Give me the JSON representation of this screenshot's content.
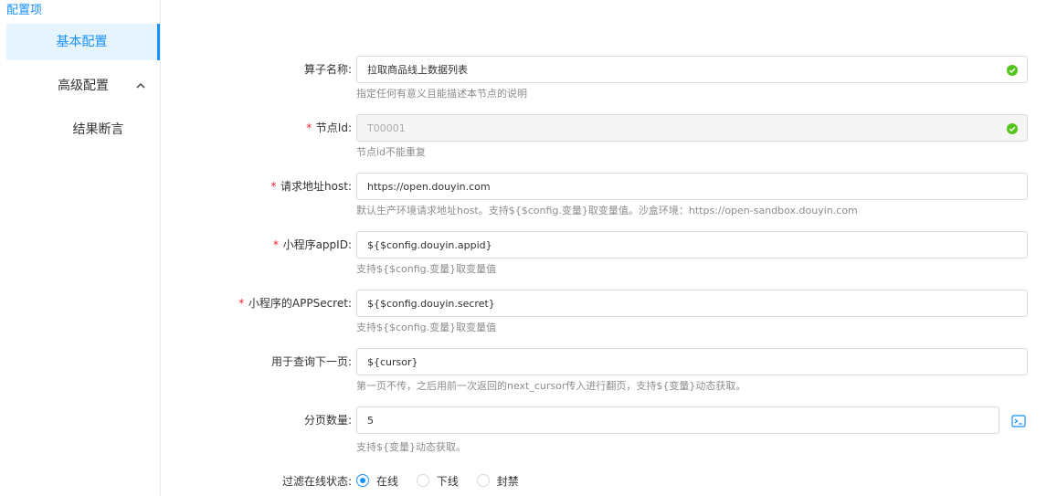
{
  "page": {
    "title": "配置项"
  },
  "sidebar": {
    "items": [
      {
        "label": "基本配置",
        "active": true
      },
      {
        "label": "高级配置",
        "expanded": true
      },
      {
        "label": "结果断言"
      }
    ]
  },
  "form": {
    "fields": [
      {
        "label": "算子名称:",
        "required": false,
        "value": "拉取商品线上数据列表",
        "help": "指定任何有意义且能描述本节点的说明",
        "valid": true,
        "disabled": false
      },
      {
        "label": "节点Id:",
        "required": true,
        "value": "T00001",
        "help": "节点id不能重复",
        "valid": true,
        "disabled": true
      },
      {
        "label": "请求地址host:",
        "required": true,
        "value": "https://open.douyin.com",
        "help": "默认生产环境请求地址host。支持${$config.变量}取变量值。沙盒环境：https://open-sandbox.douyin.com",
        "valid": false,
        "disabled": false
      },
      {
        "label": "小程序appID:",
        "required": true,
        "value": "${$config.douyin.appid}",
        "help": "支持${$config.变量}取变量值",
        "valid": false,
        "disabled": false
      },
      {
        "label": "小程序的APPSecret:",
        "required": true,
        "value": "${$config.douyin.secret}",
        "help": "支持${$config.变量}取变量值",
        "valid": false,
        "disabled": false
      },
      {
        "label": "用于查询下一页:",
        "required": false,
        "value": "${cursor}",
        "help": "第一页不传，之后用前一次返回的next_cursor传入进行翻页，支持${变量}动态获取。",
        "valid": false,
        "disabled": false
      },
      {
        "label": "分页数量:",
        "required": false,
        "value": "5",
        "help": "支持${变量}动态获取。",
        "valid": false,
        "disabled": false
      }
    ],
    "filter": {
      "label": "过滤在线状态:",
      "options": [
        {
          "label": "在线",
          "checked": true
        },
        {
          "label": "下线",
          "checked": false
        },
        {
          "label": "封禁",
          "checked": false
        }
      ]
    },
    "required_mark": "*"
  },
  "colors": {
    "primary": "#1890ff",
    "success": "#52c41a",
    "required": "#f5222d",
    "active_bg": "#e6f4ff"
  },
  "icons": {
    "valid": "check-circle-icon",
    "expand": "chevron-up-icon",
    "expression": "terminal-icon"
  }
}
